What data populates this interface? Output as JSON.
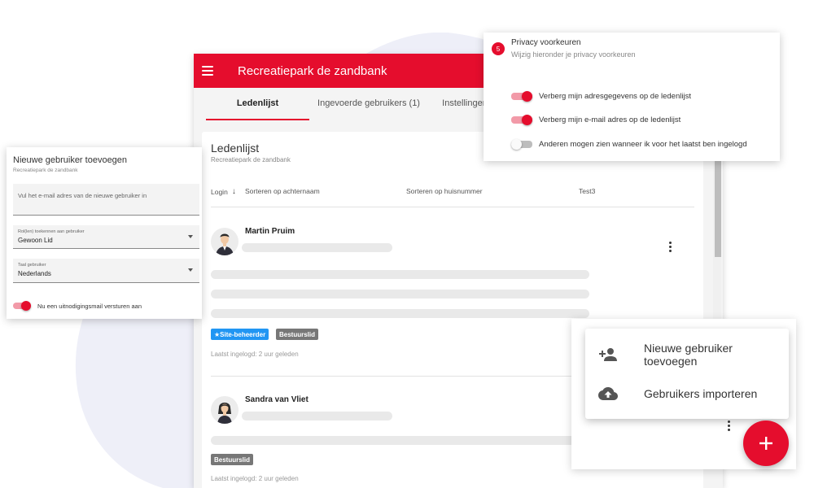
{
  "app": {
    "title": "Recreatiepark de zandbank",
    "tabs": [
      {
        "label": "Ledenlijst",
        "active": true
      },
      {
        "label": "Ingevoerde gebruikers (1)",
        "active": false
      },
      {
        "label": "Instellingen",
        "active": false
      }
    ]
  },
  "member_list": {
    "title": "Ledenlijst",
    "subtitle": "Recreatiepark de zandbank",
    "sort_columns": [
      "Login",
      "Sorteren op achternaam",
      "Sorteren op huisnummer",
      "Test3"
    ],
    "members": [
      {
        "name": "Martin Pruim",
        "badges": [
          {
            "label": "Site-beheerder",
            "icon": "star-icon",
            "color": "#2196f3"
          },
          {
            "label": "Bestuurslid",
            "color": "#777777"
          }
        ],
        "last_login": "Laatst ingelogd: 2 uur geleden"
      },
      {
        "name": "Sandra van Vliet",
        "badges": [
          {
            "label": "Bestuurslid",
            "color": "#777777"
          }
        ],
        "last_login": "Laatst ingelogd: 2 uur geleden"
      }
    ]
  },
  "new_user_dialog": {
    "title": "Nieuwe gebruiker toevoegen",
    "subtitle": "Recreatiepark de zandbank",
    "email_placeholder": "Vul het e-mail adres van de nieuwe gebruiker in",
    "role_label": "Rol(len) toekennen aan gebruiker",
    "role_value": "Gewoon Lid",
    "language_label": "Taal gebruiker",
    "language_value": "Nederlands",
    "invite_toggle_label": "Nu een uitnodigingsmail versturen aan",
    "invite_toggle_on": true
  },
  "privacy_panel": {
    "step": "5",
    "title": "Privacy voorkeuren",
    "subtitle": "Wijzig hieronder je privacy voorkeuren",
    "options": [
      {
        "label": "Verberg mijn adresgegevens op de ledenlijst",
        "on": true
      },
      {
        "label": "Verberg mijn e-mail adres op de ledenlijst",
        "on": true
      },
      {
        "label": "Anderen mogen zien wanneer ik voor het laatst ben ingelogd",
        "on": false
      }
    ]
  },
  "action_menu": {
    "items": [
      {
        "label": "Nieuwe gebruiker toevoegen",
        "icon": "person-add-icon"
      },
      {
        "label": "Gebruikers importeren",
        "icon": "cloud-upload-icon"
      }
    ],
    "fab_icon": "plus-icon"
  },
  "colors": {
    "accent": "#e50d2d",
    "badge_blue": "#2196f3",
    "badge_grey": "#777777"
  }
}
